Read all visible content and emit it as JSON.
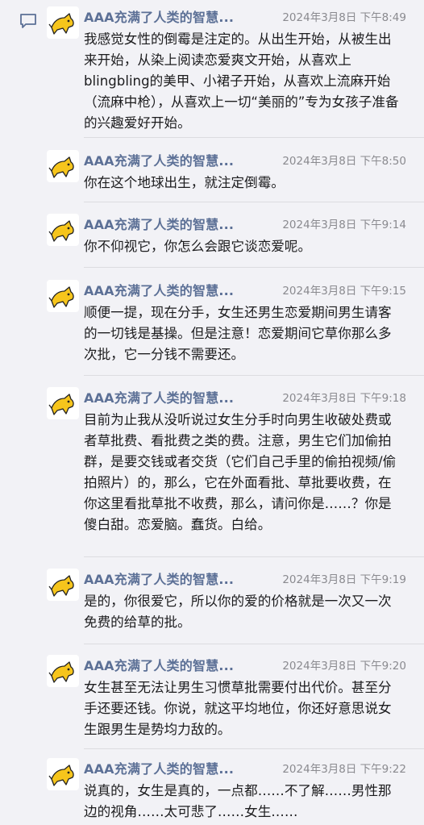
{
  "author": "AAA充满了人类的智慧...",
  "colors": {
    "background": "#f2f2f6",
    "name": "#5c7096",
    "time": "#8a8a8f",
    "text": "#1c1c1e",
    "icon": "#5c7096"
  },
  "icons": {
    "comment": "comment-bubble-icon",
    "avatar": "yellow-cat-avatar"
  },
  "comments": [
    {
      "time": "2024年3月8日 下午8:49",
      "text": "我感觉女性的倒霉是注定的。从出生开始，从被生出来开始，从染上阅读恋爱爽文开始，从喜欢上blingbling的美甲、小裙子开始，从喜欢上流麻开始（流麻中枪），从喜欢上一切“美丽的”专为女孩子准备的兴趣爱好开始。"
    },
    {
      "time": "2024年3月8日 下午8:50",
      "text": "你在这个地球出生，就注定倒霉。"
    },
    {
      "time": "2024年3月8日 下午9:14",
      "text": "你不仰视它，你怎么会跟它谈恋爱呢。"
    },
    {
      "time": "2024年3月8日 下午9:15",
      "text": "顺便一提，现在分手，女生还男生恋爱期间男生请客的一切钱是基操。但是注意！恋爱期间它草你那么多次批，它一分钱不需要还。"
    },
    {
      "time": "2024年3月8日 下午9:18",
      "text": "目前为止我从没听说过女生分手时向男生收破处费或者草批费、看批费之类的费。注意，男生它们加偷拍群，是要交钱或者交货（它们自己手里的偷拍视频/偷拍照片）的，那么，它在外面看批、草批要收费，在你这里看批草批不收费，那么，请问你是……？你是傻白甜。恋爱脑。蠢货。白给。"
    },
    {
      "time": "2024年3月8日 下午9:19",
      "text": "是的，你很爱它，所以你的爱的价格就是一次又一次免费的给草的批。"
    },
    {
      "time": "2024年3月8日 下午9:20",
      "text": "女生甚至无法让男生习惯草批需要付出代价。甚至分手还要还钱。你说，就这平均地位，你还好意思说女生跟男生是势均力敌的。"
    },
    {
      "time": "2024年3月8日 下午9:22",
      "text": "说真的，女生是真的，一点都……不了解……男性那边的视角……太可悲了……女生……"
    }
  ]
}
